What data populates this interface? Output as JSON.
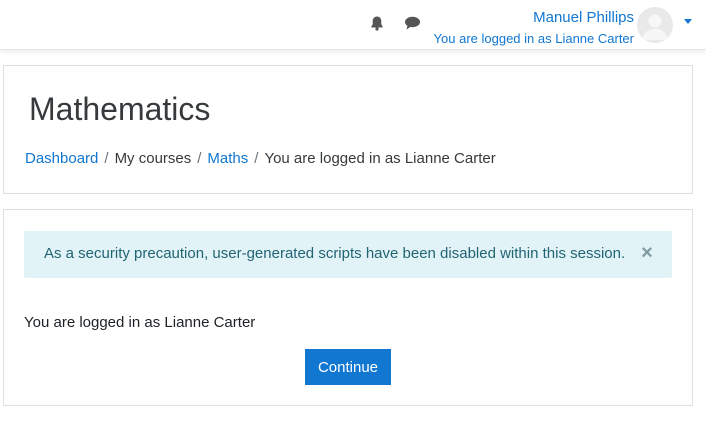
{
  "navbar": {
    "notifications_icon": "bell-icon",
    "messages_icon": "chat-bubble-icon",
    "user_name": "Manuel Phillips",
    "login_as_text": "You are logged in as Lianne Carter",
    "avatar_icon": "default-user-avatar",
    "caret_icon": "caret-down-icon",
    "accent_color": "#1177d1"
  },
  "header": {
    "title": "Mathematics",
    "breadcrumb": [
      {
        "label": "Dashboard",
        "link": true
      },
      {
        "label": "My courses",
        "link": false
      },
      {
        "label": "Maths",
        "link": true
      },
      {
        "label": "You are logged in as Lianne Carter",
        "link": false
      }
    ],
    "separator": "/"
  },
  "content": {
    "alert": {
      "message": "As a security precaution, user-generated scripts have been disabled within this session.",
      "close_symbol": "×",
      "background_color": "#e2f3f7"
    },
    "logged_in_message": "You are logged in as Lianne Carter",
    "continue_label": "Continue"
  }
}
